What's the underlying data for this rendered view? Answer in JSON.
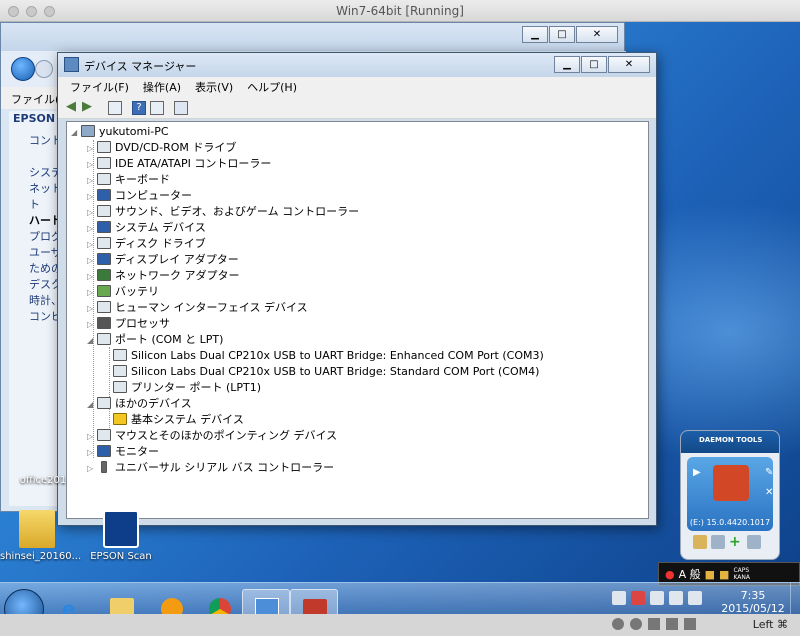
{
  "vm": {
    "title": "Win7-64bit [Running]",
    "host_key": "Left ⌘"
  },
  "control_panel": {
    "menu_file": "ファイル(",
    "side_epson": "EPSON",
    "side_items": [
      "コント",
      "",
      "システ",
      "ネット",
      "ト",
      "ハード",
      "プログ",
      "ユーザ",
      "ための",
      "デスク",
      "時計、",
      "コンピ"
    ]
  },
  "device_manager": {
    "title": "デバイス マネージャー",
    "menu": [
      "ファイル(F)",
      "操作(A)",
      "表示(V)",
      "ヘルプ(H)"
    ],
    "root": "yukutomi-PC",
    "categories": [
      "DVD/CD-ROM ドライブ",
      "IDE ATA/ATAPI コントローラー",
      "キーボード",
      "コンピューター",
      "サウンド、ビデオ、およびゲーム コントローラー",
      "システム デバイス",
      "ディスク ドライブ",
      "ディスプレイ アダプター",
      "ネットワーク アダプター",
      "バッテリ",
      "ヒューマン インターフェイス デバイス",
      "プロセッサ",
      "ポート (COM と LPT)",
      "Silicon Labs Dual CP210x USB to UART Bridge: Enhanced COM Port (COM3)",
      "Silicon Labs Dual CP210x USB to UART Bridge: Standard COM Port (COM4)",
      "プリンター ポート (LPT1)",
      "ほかのデバイス",
      "基本システム デバイス",
      "マウスとそのほかのポインティング デバイス",
      "モニター",
      "ユニバーサル シリアル バス コントローラー"
    ]
  },
  "desktop_icons": [
    {
      "label": "office201"
    },
    {
      "label": "shinsei_20160..."
    },
    {
      "label": "EPSON Scan"
    }
  ],
  "daemon": {
    "brand": "DAEMON TOOLS",
    "drive_label": "(E:) 15.0.4420.1017"
  },
  "langbar": {
    "ime": "A 般",
    "caps": "CAPS",
    "kana": "KANA"
  },
  "clock": {
    "time": "7:35",
    "date": "2015/05/12"
  }
}
